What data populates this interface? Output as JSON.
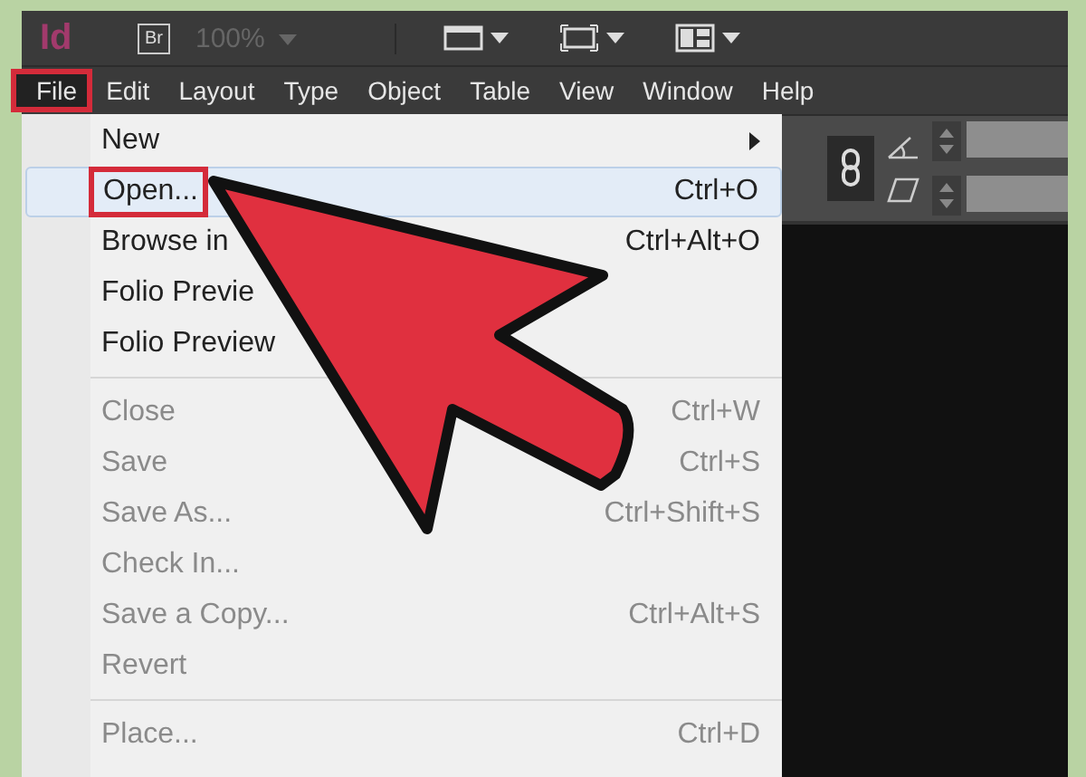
{
  "app": {
    "logo": "Id",
    "bridge": "Br",
    "zoom": "100%"
  },
  "menu_bar": [
    {
      "label": "File",
      "selected": true,
      "annotated": true
    },
    {
      "label": "Edit",
      "selected": false,
      "annotated": false
    },
    {
      "label": "Layout",
      "selected": false,
      "annotated": false
    },
    {
      "label": "Type",
      "selected": false,
      "annotated": false
    },
    {
      "label": "Object",
      "selected": false,
      "annotated": false
    },
    {
      "label": "Table",
      "selected": false,
      "annotated": false
    },
    {
      "label": "View",
      "selected": false,
      "annotated": false
    },
    {
      "label": "Window",
      "selected": false,
      "annotated": false
    },
    {
      "label": "Help",
      "selected": false,
      "annotated": false
    }
  ],
  "file_menu": {
    "groups": [
      [
        {
          "label": "New",
          "submenu": true,
          "selected": false,
          "disabled": false,
          "annotated": false
        },
        {
          "label": "Open...",
          "shortcut": "Ctrl+O",
          "selected": true,
          "disabled": false,
          "annotated": true
        },
        {
          "label": "Browse in",
          "shortcut": "Ctrl+Alt+O",
          "selected": false,
          "disabled": false,
          "annotated": false
        },
        {
          "label": "Folio Previe",
          "selected": false,
          "disabled": false,
          "annotated": false
        },
        {
          "label": "Folio Preview",
          "selected": false,
          "disabled": false,
          "annotated": false
        }
      ],
      [
        {
          "label": "Close",
          "shortcut": "Ctrl+W",
          "selected": false,
          "disabled": true,
          "annotated": false
        },
        {
          "label": "Save",
          "shortcut": "Ctrl+S",
          "selected": false,
          "disabled": true,
          "annotated": false
        },
        {
          "label": "Save As...",
          "shortcut": "Ctrl+Shift+S",
          "selected": false,
          "disabled": true,
          "annotated": false
        },
        {
          "label": "Check In...",
          "selected": false,
          "disabled": true,
          "annotated": false
        },
        {
          "label": "Save a Copy...",
          "shortcut": "Ctrl+Alt+S",
          "selected": false,
          "disabled": true,
          "annotated": false
        },
        {
          "label": "Revert",
          "selected": false,
          "disabled": true,
          "annotated": false
        }
      ],
      [
        {
          "label": "Place...",
          "shortcut": "Ctrl+D",
          "selected": false,
          "disabled": true,
          "annotated": false
        }
      ]
    ]
  }
}
